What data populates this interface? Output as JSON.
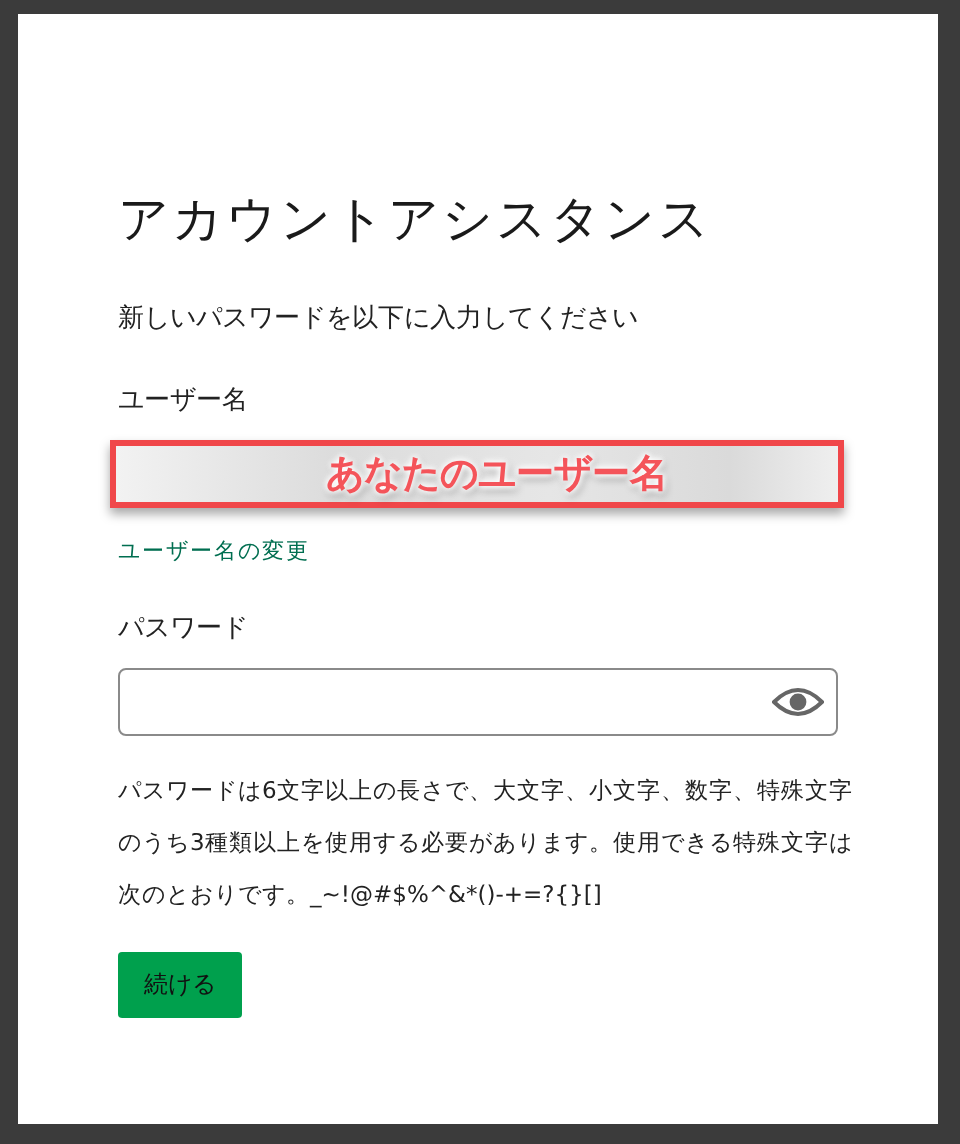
{
  "title": "アカウントアシスタンス",
  "instruction": "新しいパスワードを以下に入力してください",
  "username": {
    "label": "ユーザー名",
    "annotation": "あなたのユーザー名",
    "change_link": "ユーザー名の変更"
  },
  "password": {
    "label": "パスワード",
    "masked": true
  },
  "help_text": "パスワードは6文字以上の長さで、大文字、小文字、数字、特殊文字のうち3種類以上を使用する必要があります。使用できる特殊文字は次のとおりです。_~!@#$%^&*()-+=?{}[]",
  "buttons": [
    {
      "label": "続ける",
      "kind": "primary"
    }
  ]
}
